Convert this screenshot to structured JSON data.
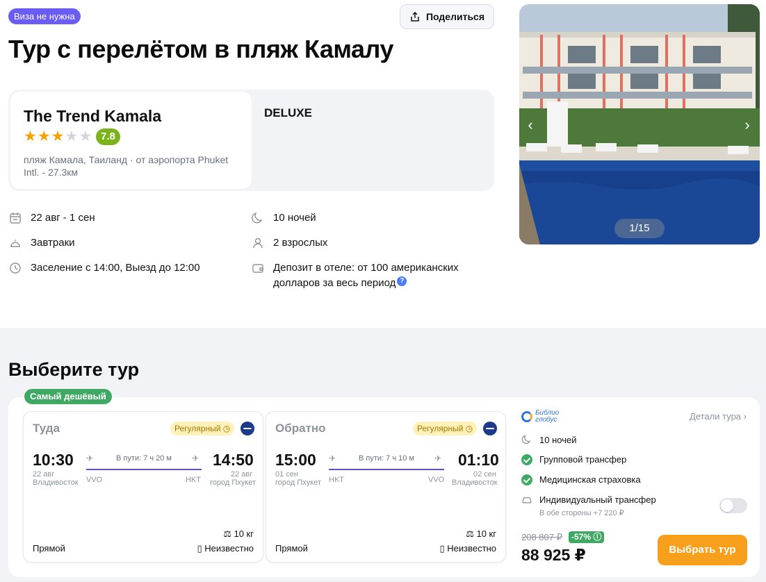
{
  "header": {
    "visa_badge": "Виза не нужна",
    "share_label": "Поделиться",
    "title": "Тур с перелётом в пляж Камалу"
  },
  "hotel": {
    "name": "The Trend Kamala",
    "stars": 3,
    "max_stars": 5,
    "rating": "7.8",
    "location": "пляж Камала, Таиланд · от аэропорта Phuket Intl. - 27.3км",
    "room_type": "DELUXE"
  },
  "facts": {
    "dates": "22 авг - 1 сен",
    "meals": "Завтраки",
    "checkin": "Заселение с 14:00, Выезд до 12:00",
    "nights": "10 ночей",
    "guests": "2 взрослых",
    "deposit": "Депозит в отеле: от 100 американских долларов за весь период"
  },
  "gallery": {
    "counter": "1/15",
    "prev_icon": "chevron-left-icon",
    "next_icon": "chevron-right-icon"
  },
  "choose": {
    "title": "Выберите тур",
    "cheapest_badge": "Самый дешёвый",
    "outbound": {
      "title": "Туда",
      "type": "Регулярный",
      "dep_time": "10:30",
      "dep_date": "22 авг",
      "dep_city": "Владивосток",
      "duration": "В пути: 7 ч 20 м",
      "dep_iata": "VVO",
      "arr_iata": "HKT",
      "arr_time": "14:50",
      "arr_date": "22 авг",
      "arr_city": "город Пхукет",
      "baggage": "10 кг",
      "stops": "Прямой",
      "luggage": "Неизвестно"
    },
    "return": {
      "title": "Обратно",
      "type": "Регулярный",
      "dep_time": "15:00",
      "dep_date": "01 сен",
      "dep_city": "город Пхукет",
      "duration": "В пути: 7 ч 10 м",
      "dep_iata": "HKT",
      "arr_iata": "VVO",
      "arr_time": "01:10",
      "arr_date": "02 сен",
      "arr_city": "Владивосток",
      "baggage": "10 кг",
      "stops": "Прямой",
      "luggage": "Неизвестно"
    },
    "operator": "Библио глобус",
    "details_link": "Детали тура",
    "options": {
      "nights": "10 ночей",
      "group_transfer": "Групповой трансфер",
      "insurance": "Медицинская страховка",
      "individual_transfer": "Индивидуальный трансфер",
      "individual_transfer_note": "В обе стороны +7 220 ₽",
      "individual_transfer_enabled": false
    },
    "old_price": "208 807 ₽",
    "discount": "-57%",
    "price": "88 925 ₽",
    "select_label": "Выбрать тур"
  },
  "colors": {
    "accent_purple": "#6b5cf6",
    "rating_green": "#7bb31a",
    "cta_orange": "#f8a01b",
    "check_green": "#3fa964"
  }
}
